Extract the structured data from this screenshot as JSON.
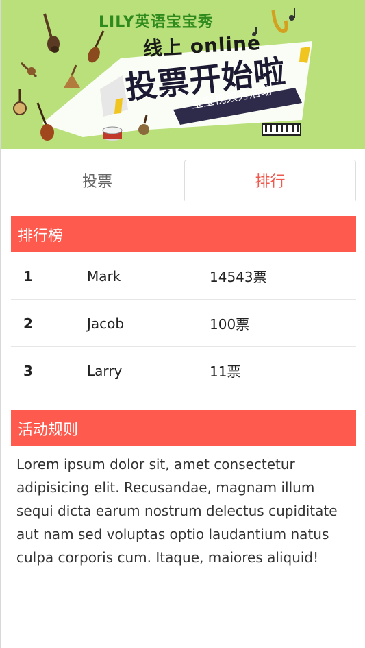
{
  "banner": {
    "brand": "LILY英语宝宝秀",
    "online_line": "线上 online",
    "big_title": "投票开始啦",
    "ribbon_text": "宝宝视频秀活动"
  },
  "tabs": [
    {
      "label": "投票",
      "active": false
    },
    {
      "label": "排行",
      "active": true
    }
  ],
  "ranking": {
    "title": "排行榜",
    "rows": [
      {
        "rank": "1",
        "name": "Mark",
        "votes": "14543票"
      },
      {
        "rank": "2",
        "name": "Jacob",
        "votes": "100票"
      },
      {
        "rank": "3",
        "name": "Larry",
        "votes": "11票"
      }
    ]
  },
  "rules": {
    "title": "活动规则",
    "text": "Lorem ipsum dolor sit, amet consectetur adipisicing elit. Recusandae, magnam illum sequi dicta earum nostrum delectus cupiditate aut nam sed voluptas optio laudantium natus culpa corporis cum. Itaque, maiores aliquid!"
  },
  "colors": {
    "banner_bg": "#b9e07a",
    "accent": "#ff5a4e",
    "active_tab_text": "#ee5a4f"
  }
}
